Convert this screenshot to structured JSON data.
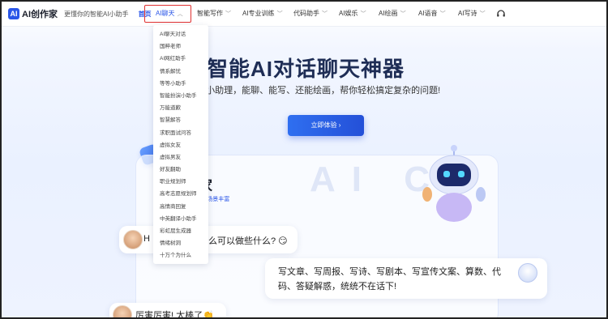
{
  "header": {
    "logo_mark": "AI",
    "logo_text": "AI创作家",
    "slogan": "更懂你的智能AI小助手",
    "home": "首页",
    "nav": [
      {
        "label": "AI聊天",
        "active": true
      },
      {
        "label": "智能写作"
      },
      {
        "label": "AI专业训练"
      },
      {
        "label": "代码助手"
      },
      {
        "label": "AI娱乐"
      },
      {
        "label": "AI绘画"
      },
      {
        "label": "AI语音"
      },
      {
        "label": "AI写诗"
      }
    ],
    "support_icon": "headset-icon"
  },
  "dropdown": {
    "items": [
      "AI聊天对话",
      "国粹老师",
      "AI网红助手",
      "情系解忧",
      "等等小助手",
      "智能扮演小助手",
      "万能道歉",
      "智慧解答",
      "求职面试问答",
      "虚拟女友",
      "虚拟男友",
      "好友翻助",
      "职业规划师",
      "高考志愿规划师",
      "高情商回复",
      "中英翻译小助手",
      "彩虹屁生成器",
      "情绪树洞",
      "十万个为什么"
    ]
  },
  "hero": {
    "title": "智能AI对话聊天神器",
    "subtitle": "真人的AI小助理，能聊、能写、还能绘画，帮你轻松搞定复杂的问题!",
    "cta": "立即体验 ›"
  },
  "card": {
    "bg_text": "AI C",
    "title": "作家",
    "tagline": "能高效 · 场景丰富"
  },
  "chat": {
    "b1": "H",
    "b1_tail": "么可以做些什么? 😏",
    "b2": "写文章、写周报、写诗、写剧本、写宣传文案、算数、代码、答疑解惑，统统不在话下!",
    "b3": "厉害厉害! 太棒了👏"
  },
  "colors": {
    "accent": "#2a56e8",
    "title": "#1e2d55",
    "highlight_border": "#e03030"
  }
}
